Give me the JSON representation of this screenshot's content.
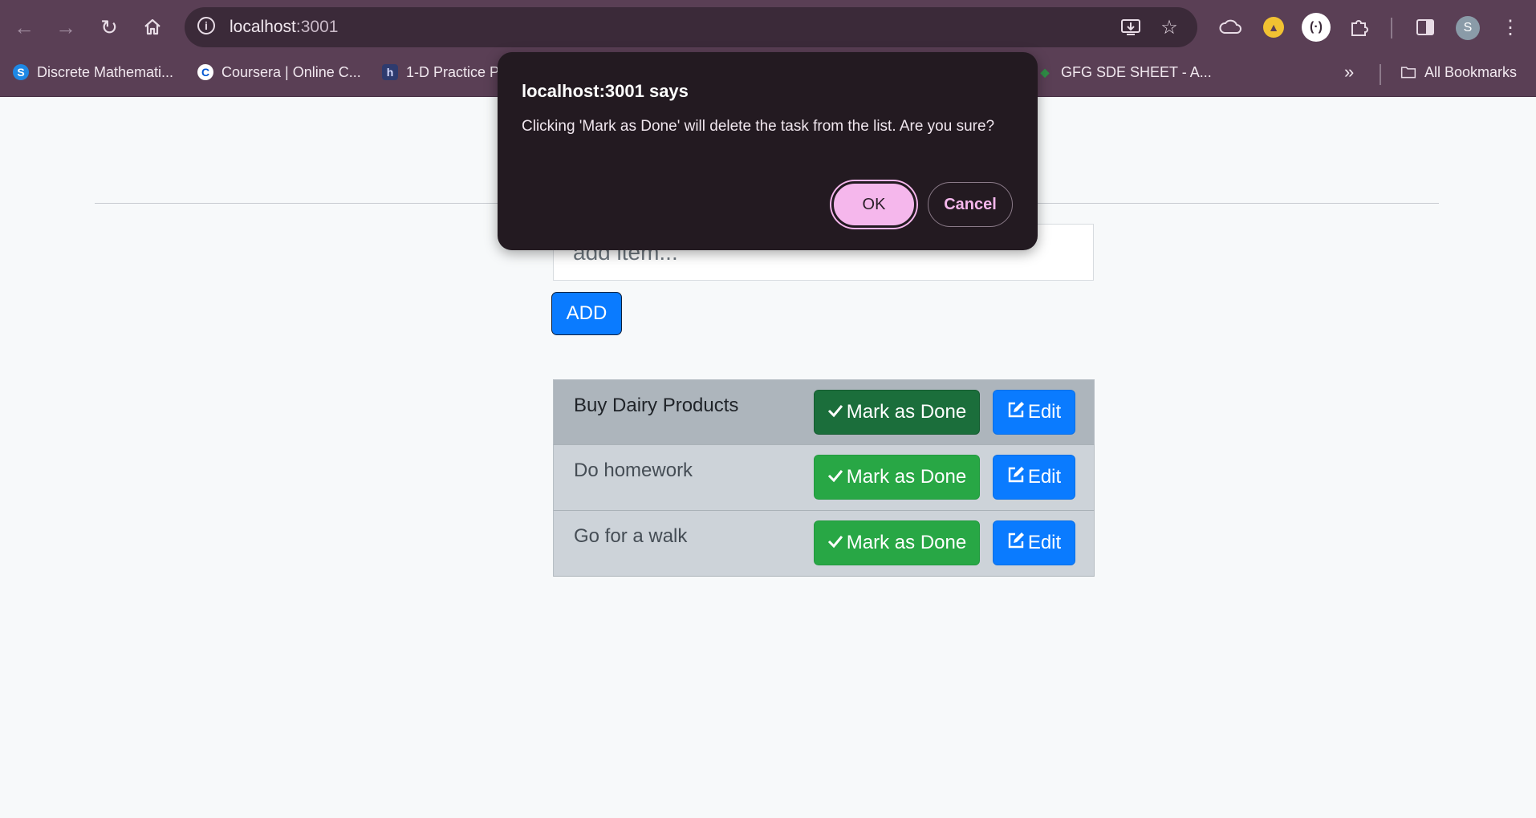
{
  "browser": {
    "url_host": "localhost",
    "url_port": ":3001",
    "avatar_letter": "S",
    "bookmarks": [
      {
        "label": "Discrete Mathemati...",
        "icon": "s-logo-icon"
      },
      {
        "label": "Coursera | Online C...",
        "icon": "coursera-icon"
      },
      {
        "label": "1-D Practice P",
        "icon": "hackerrank-icon"
      },
      {
        "label": "GFG SDE SHEET - A...",
        "icon": "gfg-icon"
      }
    ],
    "more_bookmarks_glyph": "»",
    "all_bookmarks_label": "All Bookmarks"
  },
  "dialog": {
    "title": "localhost:3001 says",
    "message": "Clicking 'Mark as Done' will delete the task from the list. Are you sure?",
    "ok_label": "OK",
    "cancel_label": "Cancel"
  },
  "app": {
    "input_placeholder": "add item...",
    "add_label": "ADD",
    "mark_done_label": "Mark as Done",
    "edit_label": "Edit",
    "tasks": [
      {
        "text": "Buy Dairy Products"
      },
      {
        "text": "Do homework"
      },
      {
        "text": "Go for a walk"
      }
    ]
  },
  "colors": {
    "chrome": "#5a3f55",
    "dialog_bg": "#231a21",
    "ok_button": "#f5b7ec",
    "primary": "#0a7bff",
    "success": "#28a745",
    "success_dark": "#1b6e3b"
  }
}
